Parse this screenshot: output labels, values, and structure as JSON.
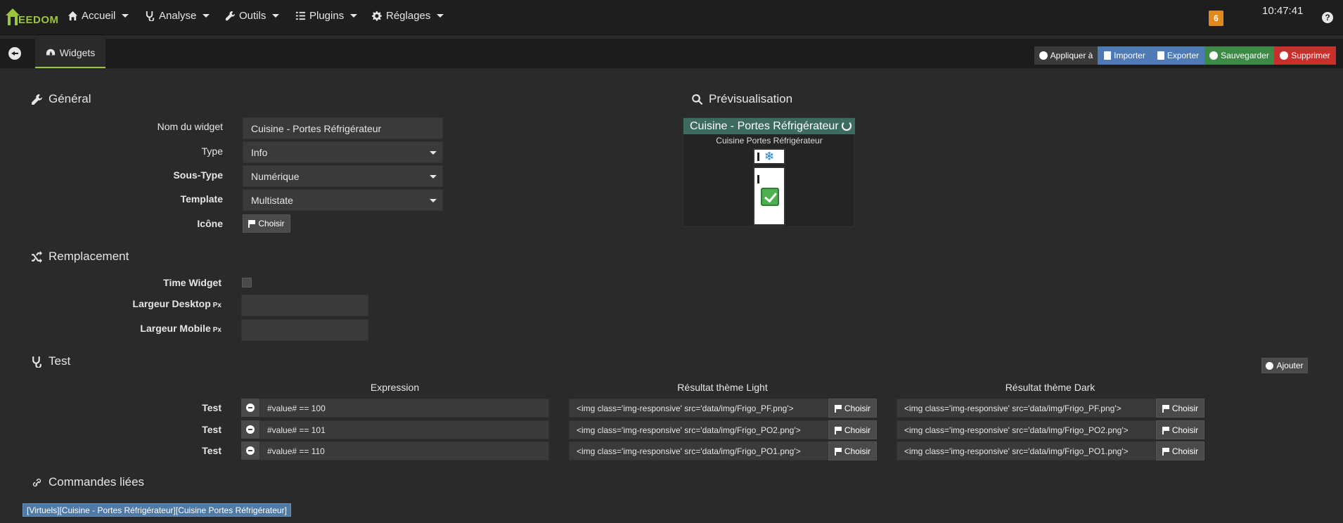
{
  "navbar": {
    "logo_text": "EEDOM",
    "menu": [
      {
        "label": "Accueil"
      },
      {
        "label": "Analyse"
      },
      {
        "label": "Outils"
      },
      {
        "label": "Plugins"
      },
      {
        "label": "Réglages"
      }
    ],
    "notification_count": "6",
    "time": "10:47:41",
    "help": "?"
  },
  "tabbar": {
    "tab_label": "Widgets"
  },
  "actions": {
    "apply": "Appliquer à",
    "import": "Importer",
    "export": "Exporter",
    "save": "Sauvegarder",
    "delete": "Supprimer"
  },
  "general": {
    "title": "Général",
    "name_label": "Nom du widget",
    "name_value": "Cuisine - Portes Réfrigérateur",
    "type_label": "Type",
    "type_value": "Info",
    "subtype_label": "Sous-Type",
    "subtype_value": "Numérique",
    "template_label": "Template",
    "template_value": "Multistate",
    "icon_label": "Icône",
    "choose": "Choisir"
  },
  "preview": {
    "title": "Prévisualisation",
    "header": "Cuisine - Portes Réfrigérateur",
    "subtitle": "Cuisine Portes Réfrigérateur",
    "snow": "❄"
  },
  "replacement": {
    "title": "Remplacement",
    "time_widget_label": "Time Widget",
    "desktop_label": "Largeur Desktop",
    "mobile_label": "Largeur Mobile",
    "px": "Px"
  },
  "test": {
    "title": "Test",
    "add": "Ajouter",
    "col_expression": "Expression",
    "col_light": "Résultat thème Light",
    "col_dark": "Résultat thème Dark",
    "row_label": "Test",
    "choose": "Choisir",
    "rows": [
      {
        "expression": "#value# == 100",
        "light": "<img class='img-responsive' src='data/img/Frigo_PF.png'>",
        "dark": "<img class='img-responsive' src='data/img/Frigo_PF.png'>"
      },
      {
        "expression": "#value# == 101",
        "light": "<img class='img-responsive' src='data/img/Frigo_PO2.png'>",
        "dark": "<img class='img-responsive' src='data/img/Frigo_PO2.png'>"
      },
      {
        "expression": "#value# == 110",
        "light": "<img class='img-responsive' src='data/img/Frigo_PO1.png'>",
        "dark": "<img class='img-responsive' src='data/img/Frigo_PO1.png'>"
      }
    ]
  },
  "linked": {
    "title": "Commandes liées",
    "command": "[Virtuels][Cuisine - Portes Réfrigérateur][Cuisine Portes Réfrigérateur]"
  },
  "colors": {
    "accent": "#9bc53d",
    "apply": "#3a3a3a",
    "import": "#4f7ab8",
    "export": "#4f7ab8",
    "save": "#3d8a46",
    "delete": "#c9302c"
  }
}
